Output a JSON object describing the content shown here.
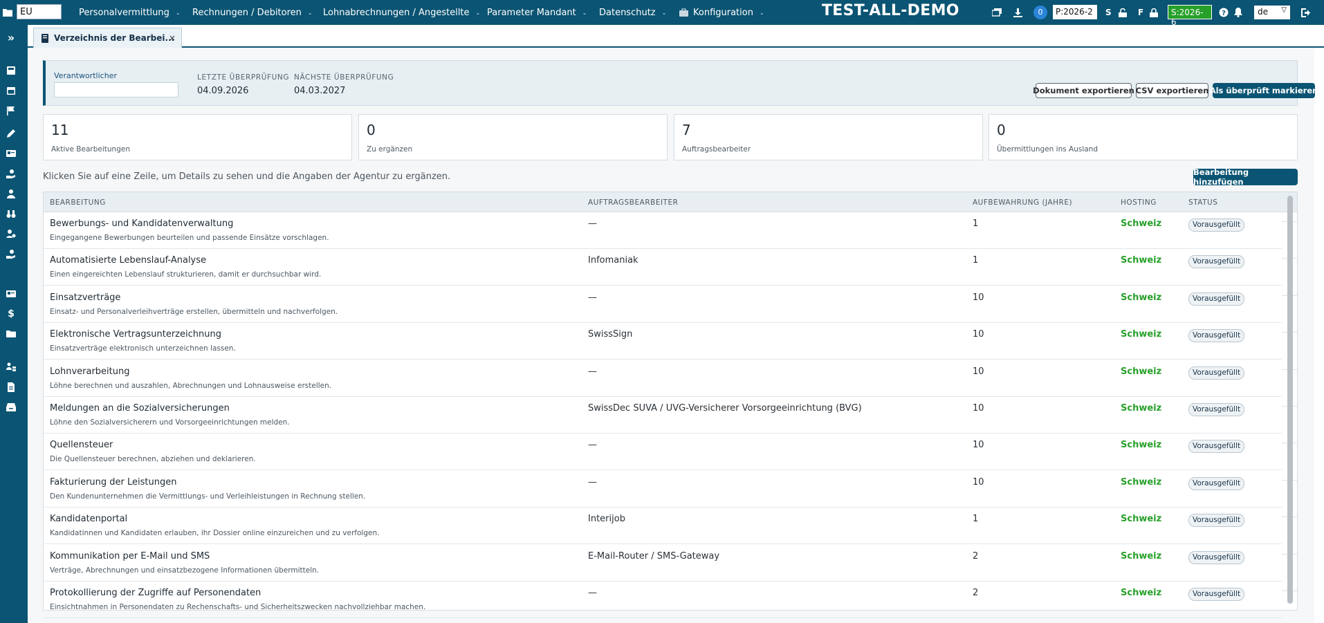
{
  "topbar": {
    "client_value": "EU",
    "menu": [
      {
        "label": "Personalvermittlung"
      },
      {
        "label": "Rechnungen / Debitoren"
      },
      {
        "label": "Lohnabrechnungen / Angestellte"
      },
      {
        "label": "Parameter Mandant"
      },
      {
        "label": "Datenschutz"
      },
      {
        "label": "Konfiguration"
      }
    ],
    "brand": "TEST-ALL-DEMO",
    "notification_count": "0",
    "period_p": "P:2026-2",
    "label_s": "S",
    "label_f": "F",
    "period_s": "S:2026-6",
    "language": "de",
    "icons": [
      "folder-icon",
      "layers-icon",
      "download-icon",
      "lock-open-icon",
      "lock-icon",
      "help-icon",
      "bell-icon",
      "logout-icon"
    ]
  },
  "sidebar": {
    "icons": [
      "expand-icon",
      "calculator-icon",
      "calendar-icon",
      "flag-icon",
      "pencil-icon",
      "id-card-icon",
      "hand-money-icon",
      "person-icon",
      "binoculars-icon",
      "user-gear-icon",
      "hand-money-icon",
      "id-card-icon",
      "dollar-icon",
      "folder-icon",
      "person-hierarchy-icon",
      "document-icon",
      "inbox-icon"
    ]
  },
  "tab": {
    "label": "Verzeichnis der Bearbei...",
    "close": "×"
  },
  "review": {
    "responsible_label": "Verantwortlicher",
    "responsible_value": "",
    "last_review_label": "LETZTE ÜBERPRÜFUNG",
    "last_review_value": "04.09.2026",
    "next_review_label": "NÄCHSTE ÜBERPRÜFUNG",
    "next_review_value": "04.03.2027",
    "export_doc_label": "Dokument exportieren",
    "export_csv_label": "CSV exportieren",
    "mark_reviewed_label": "Als überprüft markieren"
  },
  "stats": [
    {
      "value": "11",
      "label": "Aktive Bearbeitungen"
    },
    {
      "value": "0",
      "label": "Zu ergänzen"
    },
    {
      "value": "7",
      "label": "Auftragsbearbeiter"
    },
    {
      "value": "0",
      "label": "Übermittlungen ins Ausland"
    }
  ],
  "hint": "Klicken Sie auf eine Zeile, um Details zu sehen und die Angaben der Agentur zu ergänzen.",
  "add_button_label": "Bearbeitung hinzufügen",
  "table": {
    "columns": [
      "BEARBEITUNG",
      "AUFTRAGSBEARBEITER",
      "AUFBEWAHRUNG (JAHRE)",
      "HOSTING",
      "STATUS"
    ],
    "rows": [
      {
        "name": "Bewerbungs- und Kandidatenverwaltung",
        "desc": "Eingegangene Bewerbungen beurteilen und passende Einsätze vorschlagen.",
        "processor": "—",
        "retention": "1",
        "hosting": "Schweiz",
        "status": "Vorausgefüllt"
      },
      {
        "name": "Automatisierte Lebenslauf-Analyse",
        "desc": "Einen eingereichten Lebenslauf strukturieren, damit er durchsuchbar wird.",
        "processor": "Infomaniak",
        "retention": "1",
        "hosting": "Schweiz",
        "status": "Vorausgefüllt"
      },
      {
        "name": "Einsatzverträge",
        "desc": "Einsatz- und Personalverleihverträge erstellen, übermitteln und nachverfolgen.",
        "processor": "—",
        "retention": "10",
        "hosting": "Schweiz",
        "status": "Vorausgefüllt"
      },
      {
        "name": "Elektronische Vertragsunterzeichnung",
        "desc": "Einsatzverträge elektronisch unterzeichnen lassen.",
        "processor": "SwissSign",
        "retention": "10",
        "hosting": "Schweiz",
        "status": "Vorausgefüllt"
      },
      {
        "name": "Lohnverarbeitung",
        "desc": "Löhne berechnen und auszahlen, Abrechnungen und Lohnausweise erstellen.",
        "processor": "—",
        "retention": "10",
        "hosting": "Schweiz",
        "status": "Vorausgefüllt"
      },
      {
        "name": "Meldungen an die Sozialversicherungen",
        "desc": "Löhne den Sozialversicherern und Vorsorgeeinrichtungen melden.",
        "processor": "SwissDec  SUVA / UVG-Versicherer  Vorsorgeeinrichtung (BVG)",
        "retention": "10",
        "hosting": "Schweiz",
        "status": "Vorausgefüllt"
      },
      {
        "name": "Quellensteuer",
        "desc": "Die Quellensteuer berechnen, abziehen und deklarieren.",
        "processor": "—",
        "retention": "10",
        "hosting": "Schweiz",
        "status": "Vorausgefüllt"
      },
      {
        "name": "Fakturierung der Leistungen",
        "desc": "Den Kundenunternehmen die Vermittlungs- und Verleihleistungen in Rechnung stellen.",
        "processor": "—",
        "retention": "10",
        "hosting": "Schweiz",
        "status": "Vorausgefüllt"
      },
      {
        "name": "Kandidatenportal",
        "desc": "Kandidatinnen und Kandidaten erlauben, ihr Dossier online einzureichen und zu verfolgen.",
        "processor": "Interijob",
        "retention": "1",
        "hosting": "Schweiz",
        "status": "Vorausgefüllt"
      },
      {
        "name": "Kommunikation per E-Mail und SMS",
        "desc": "Verträge, Abrechnungen und einsatzbezogene Informationen übermitteln.",
        "processor": "E-Mail-Router / SMS-Gateway",
        "retention": "2",
        "hosting": "Schweiz",
        "status": "Vorausgefüllt"
      },
      {
        "name": "Protokollierung der Zugriffe auf Personendaten",
        "desc": "Einsichtnahmen in Personendaten zu Rechenschafts- und Sicherheitszwecken nachvollziehbar machen.",
        "processor": "—",
        "retention": "2",
        "hosting": "Schweiz",
        "status": "Vorausgefüllt"
      }
    ]
  },
  "colors": {
    "brand": "#0b5473",
    "hosting_green": "#27a02a",
    "highlight_period": "#27a02a"
  }
}
